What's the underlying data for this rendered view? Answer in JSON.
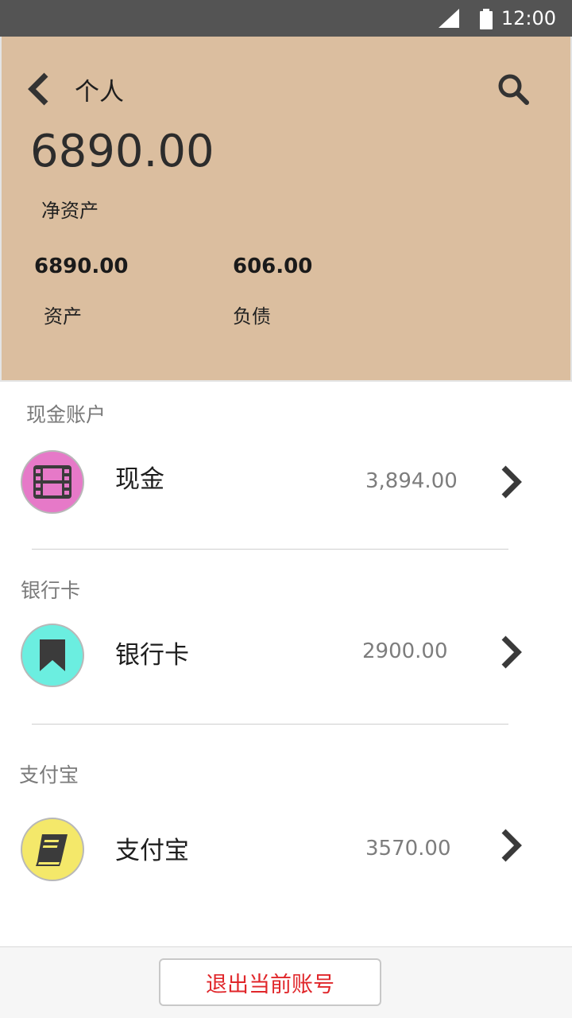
{
  "status_bar": {
    "time": "12:00"
  },
  "header": {
    "title": "个人",
    "net_value": "6890.00",
    "net_label": "净资产",
    "assets_value": "6890.00",
    "assets_label": "资产",
    "debt_value": "606.00",
    "debt_label": "负债",
    "background_color": "#dbbe9f"
  },
  "accounts": [
    {
      "section": "现金账户",
      "name": "现金",
      "amount": "3,894.00",
      "icon": "film-icon",
      "icon_color": "#e679c8"
    },
    {
      "section": "银行卡",
      "name": "银行卡",
      "amount": "2900.00",
      "icon": "bookmark-icon",
      "icon_color": "#6beee0"
    },
    {
      "section": "支付宝",
      "name": "支付宝",
      "amount": "3570.00",
      "icon": "book-icon",
      "icon_color": "#f4e86a"
    }
  ],
  "footer": {
    "logout_label": "退出当前账号",
    "logout_color": "#e0262a"
  }
}
